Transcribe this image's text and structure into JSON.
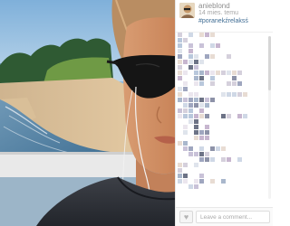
{
  "post": {
    "username": "anieblond",
    "timestamp": "14 mies. temu",
    "hashtag": "#poranekźrelaksś"
  },
  "comment_bar": {
    "placeholder": "Leave a comment...",
    "like_icon": "heart-icon"
  },
  "colors": {
    "link": "#3f6c93",
    "muted_text": "#8d8d8d",
    "sky": "#8fb9dd",
    "sand": "#d8bb93",
    "water": "#5f8fb0"
  }
}
